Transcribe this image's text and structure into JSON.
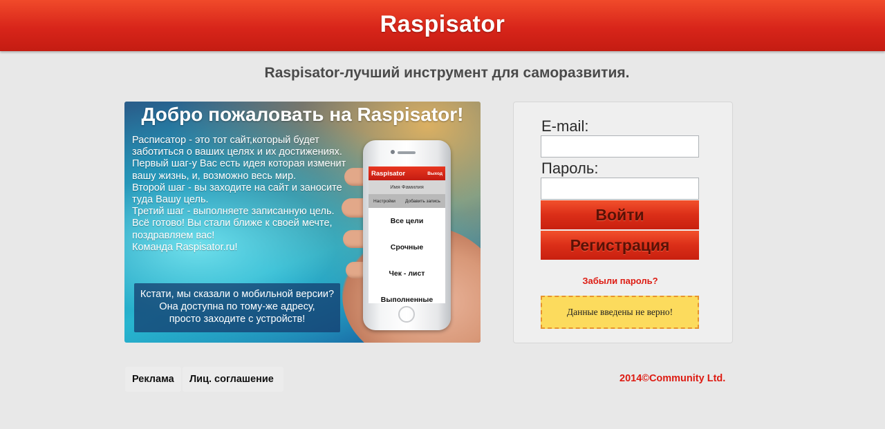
{
  "header": {
    "title": "Raspisator"
  },
  "tagline": "Raspisator-лучший инструмент для саморазвития.",
  "promo": {
    "title": "Добро пожаловать на Raspisator!",
    "text_lines": [
      "Расписатор - это тот сайт,который будет",
      "заботиться о ваших целях и их достижениях.",
      "Первый шаг-у Вас есть идея которая изменит",
      "вашу жизнь, и, возможно весь мир.",
      "Второй шаг - вы заходите на сайт и заносите",
      "туда Вашу цель.",
      "Третий шаг - выполняете записанную цель.",
      "Всё готово! Вы стали ближе к своей мечте,",
      "поздравляем вас!",
      "Команда Raspisator.ru!"
    ],
    "mobile_note_lines": [
      "Кстати, мы сказали о мобильной версии?",
      "Она доступна по тому-же адресу,",
      "просто заходите с устройств!"
    ],
    "phone": {
      "app_title": "Raspisator",
      "exit_label": "Выход",
      "user_name": "Имя Фамилия",
      "tab_settings": "Настройки",
      "tab_add": "Добавить запись",
      "items": [
        "Все цели",
        "Срочные",
        "Чек - лист",
        "Выполненные"
      ]
    }
  },
  "login": {
    "email_label": "E-mail:",
    "email_value": "",
    "password_label": "Пароль:",
    "password_value": "",
    "login_button": "Войти",
    "register_button": "Регистрация",
    "forgot_link": "Забыли пароль?",
    "error_message": "Данные введены не верно!"
  },
  "footer": {
    "ads_label": "Реклама",
    "license_label": "Лиц. соглашение",
    "copyright": "2014©Community Ltd."
  },
  "colors": {
    "accent_red": "#d8251a",
    "error_bg": "#fcdb5d",
    "link_red": "#dd1b12"
  }
}
